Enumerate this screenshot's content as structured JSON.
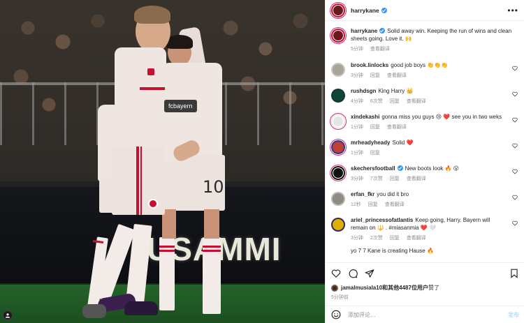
{
  "post": {
    "author": "harrykane",
    "caption": "Solid away win. Keeping the run of wins and clean sheets going. Love it. 🙌",
    "caption_time": "5分钟",
    "caption_translate": "查看翻译",
    "more": "•••"
  },
  "photo": {
    "shirt_tag": "fcbayern",
    "adboard_text": "USAMMI",
    "player_number": "10"
  },
  "comments": [
    {
      "user": "brook.linlocks",
      "text": "good job boys 👏👏👏",
      "time": "3分钟",
      "likes": "",
      "reply": "回复",
      "translate": "查看翻译",
      "verified": false
    },
    {
      "user": "rushdsgn",
      "text": "King Harry 👑",
      "time": "4分钟",
      "likes": "6次赞",
      "reply": "回复",
      "translate": "查看翻译",
      "verified": false
    },
    {
      "user": "xindekashi",
      "text": "gonna miss you guys 😢 ❤️ see you in two weks",
      "time": "1分钟",
      "likes": "",
      "reply": "回复",
      "translate": "查看翻译",
      "verified": false
    },
    {
      "user": "mrheadyheady",
      "text": "Solid ❤️",
      "time": "1分钟",
      "likes": "",
      "reply": "回复",
      "translate": "",
      "verified": false
    },
    {
      "user": "skechersfootball",
      "text": "New boots look 🔥 😮",
      "time": "3分钟",
      "likes": "7次赞",
      "reply": "回复",
      "translate": "查看翻译",
      "verified": true
    },
    {
      "user": "erfan_fkr",
      "text": "you did it bro",
      "time": "12秒",
      "likes": "",
      "reply": "回复",
      "translate": "查看翻译",
      "verified": false
    },
    {
      "user": "ariel_princessofatlantis",
      "text": "Keep going, Harry. Bayern will remain on 🔱 . #miasanmia ❤️ 🤍",
      "time": "3分钟",
      "likes": "2次赞",
      "reply": "回复",
      "translate": "查看翻译",
      "verified": false
    }
  ],
  "truncated_comment": "yo 7 7 Kane is creating Hause 🔥",
  "likes_line": {
    "user": "jamalmusiala10",
    "text": "和其他4487位用户",
    "suffix": "赞了"
  },
  "post_time": "5分钟前",
  "add_comment": {
    "placeholder": "添加评论…",
    "post_label": "发布"
  },
  "icons": {
    "heart": "heart-icon",
    "comment": "comment-icon",
    "share": "share-icon",
    "bookmark": "bookmark-icon",
    "emoji": "emoji-icon"
  },
  "colors": {
    "verified": "#3897f0",
    "muted": "#8e8e8e",
    "post_button": "#b2dffc",
    "bayern_red": "#c8102e"
  }
}
